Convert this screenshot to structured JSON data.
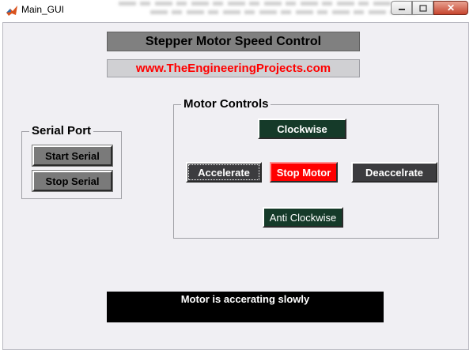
{
  "window": {
    "title": "Main_GUI",
    "controls": {
      "minimize_icon": "minimize-icon",
      "maximize_icon": "maximize-icon",
      "close_glyph": "✕"
    }
  },
  "header": {
    "title": "Stepper Motor Speed Control",
    "website": "www.TheEngineeringProjects.com"
  },
  "serial_port": {
    "title": "Serial Port",
    "start_label": "Start Serial",
    "stop_label": "Stop Serial"
  },
  "motor_controls": {
    "title": "Motor Controls",
    "clockwise_label": "Clockwise",
    "accelerate_label": "Accelerate",
    "stop_label": "Stop Motor",
    "decelerate_label": "Deaccelrate",
    "anticlockwise_label": "Anti Clockwise"
  },
  "status": {
    "message": "Motor is accerating slowly"
  },
  "colors": {
    "heading_bg": "#808080",
    "website_text": "#ff0000",
    "green_button": "#153a29",
    "dark_button": "#3c3c3f",
    "stop_button": "#ff0000",
    "status_bg": "#000000"
  }
}
